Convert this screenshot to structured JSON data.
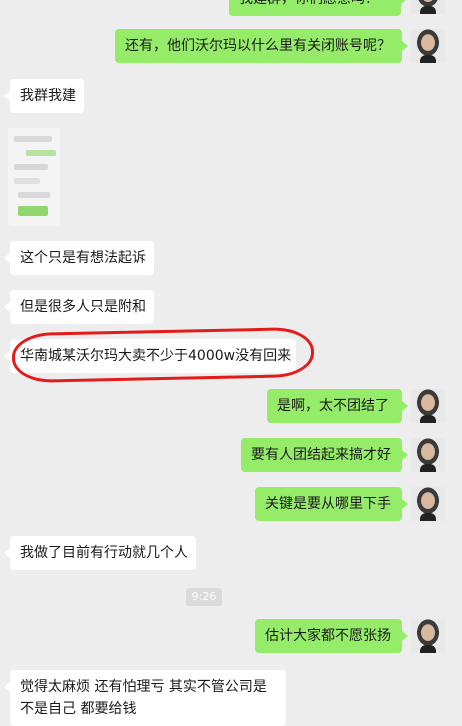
{
  "messages": [
    {
      "side": "right",
      "text": "我建群，你们愿意吗？"
    },
    {
      "side": "right",
      "text": "还有，他们沃尔玛以什么里有关闭账号呢？"
    },
    {
      "side": "left",
      "text": "我群我建"
    },
    {
      "side": "left",
      "text": "这个只是有想法起诉"
    },
    {
      "side": "left",
      "text": "但是很多人只是附和"
    },
    {
      "side": "left",
      "text": "华南城某沃尔玛大卖不少于4000w没有回来"
    },
    {
      "side": "right",
      "text": "是啊，太不团结了"
    },
    {
      "side": "right",
      "text": "要有人团结起来搞才好"
    },
    {
      "side": "right",
      "text": "关键是要从哪里下手"
    },
    {
      "side": "left",
      "text": "我做了目前有行动就几个人"
    },
    {
      "side": "right",
      "text": "估计大家都不愿张扬"
    },
    {
      "side": "left",
      "text": "觉得太麻烦 还有怕理亏 其实不管公司是不是自己 都要给钱"
    }
  ],
  "timestamp": "9:26",
  "colors": {
    "background": "#ededed",
    "bubble_sent": "#95ec69",
    "bubble_received": "#ffffff",
    "highlight": "#e31b1b"
  }
}
